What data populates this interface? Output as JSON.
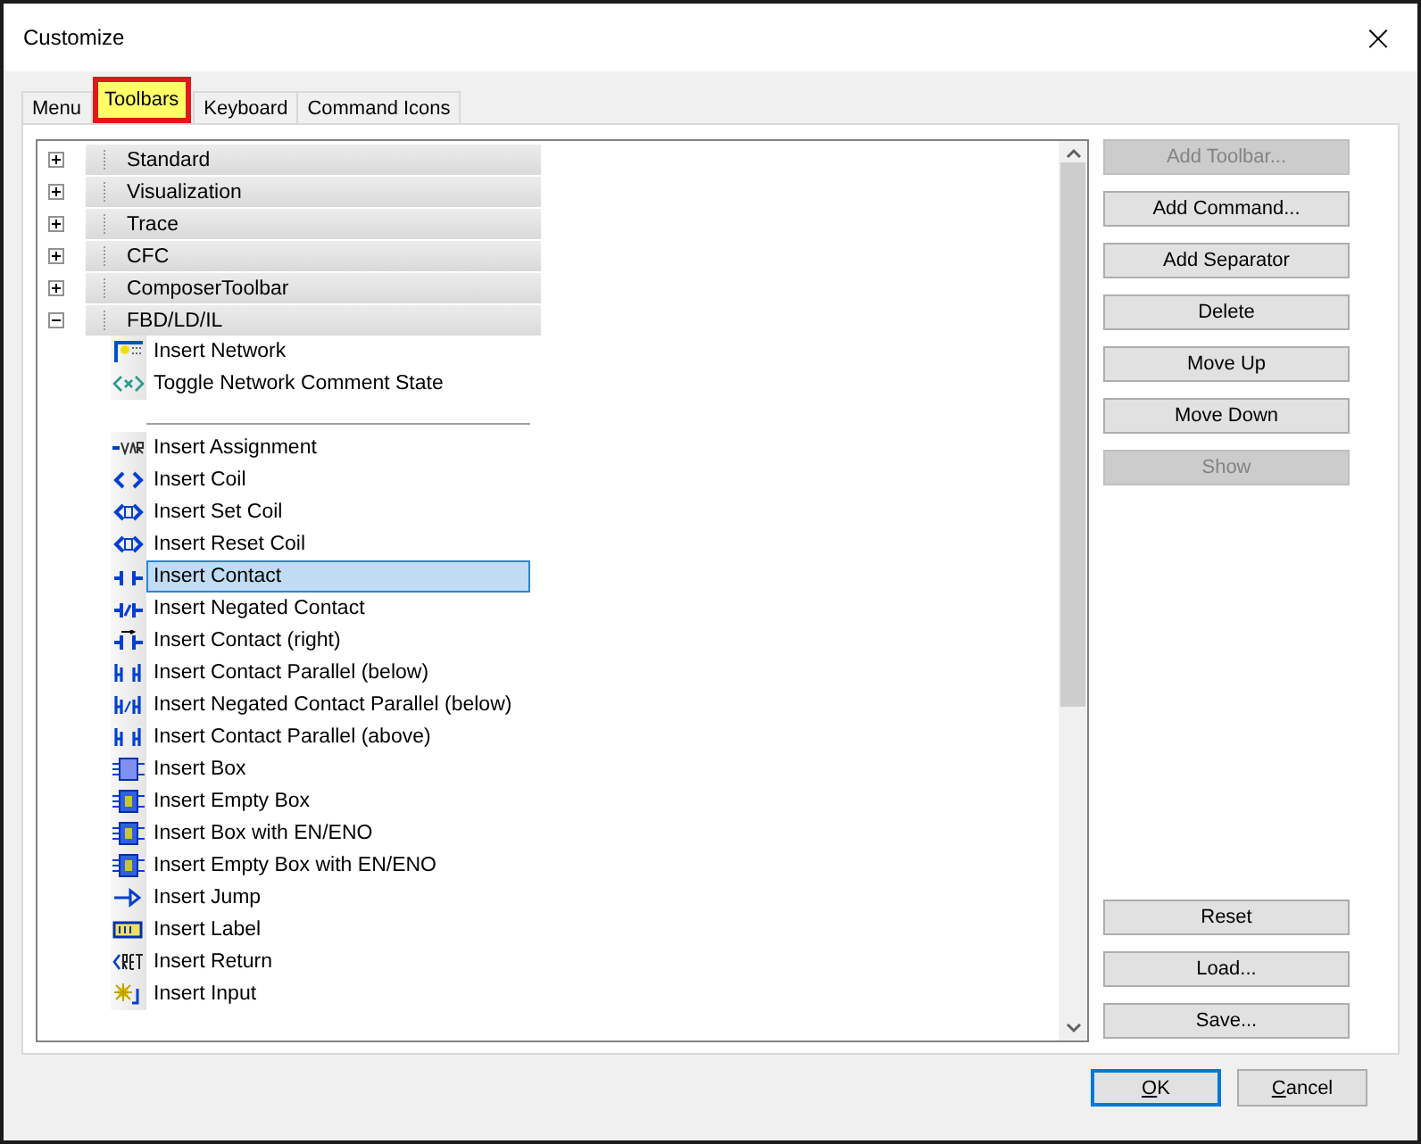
{
  "window": {
    "title": "Customize",
    "close": "×"
  },
  "tabs": [
    {
      "label": "Menu",
      "selected": false
    },
    {
      "label": "Toolbars",
      "selected": true
    },
    {
      "label": "Keyboard",
      "selected": false
    },
    {
      "label": "Command Icons",
      "selected": false
    }
  ],
  "toolbars": [
    {
      "name": "Standard",
      "expanded": false
    },
    {
      "name": "Visualization",
      "expanded": false
    },
    {
      "name": "Trace",
      "expanded": false
    },
    {
      "name": "CFC",
      "expanded": false
    },
    {
      "name": "ComposerToolbar",
      "expanded": false
    },
    {
      "name": "FBD/LD/IL",
      "expanded": true,
      "commands": [
        {
          "kind": "command",
          "label": "Insert Network",
          "selected": false
        },
        {
          "kind": "command",
          "label": "Toggle Network Comment State",
          "selected": false
        },
        {
          "kind": "separator"
        },
        {
          "kind": "command",
          "label": "Insert Assignment",
          "selected": false
        },
        {
          "kind": "command",
          "label": "Insert Coil",
          "selected": false
        },
        {
          "kind": "command",
          "label": "Insert Set Coil",
          "selected": false
        },
        {
          "kind": "command",
          "label": "Insert Reset Coil",
          "selected": false
        },
        {
          "kind": "command",
          "label": "Insert Contact",
          "selected": true
        },
        {
          "kind": "command",
          "label": "Insert Negated Contact",
          "selected": false
        },
        {
          "kind": "command",
          "label": "Insert Contact (right)",
          "selected": false
        },
        {
          "kind": "command",
          "label": "Insert Contact Parallel (below)",
          "selected": false
        },
        {
          "kind": "command",
          "label": "Insert Negated Contact Parallel (below)",
          "selected": false
        },
        {
          "kind": "command",
          "label": "Insert Contact Parallel (above)",
          "selected": false
        },
        {
          "kind": "command",
          "label": "Insert Box",
          "selected": false
        },
        {
          "kind": "command",
          "label": "Insert Empty Box",
          "selected": false
        },
        {
          "kind": "command",
          "label": "Insert Box with EN/ENO",
          "selected": false
        },
        {
          "kind": "command",
          "label": "Insert Empty Box with EN/ENO",
          "selected": false
        },
        {
          "kind": "command",
          "label": "Insert Jump",
          "selected": false
        },
        {
          "kind": "command",
          "label": "Insert Label",
          "selected": false
        },
        {
          "kind": "command",
          "label": "Insert Return",
          "selected": false
        },
        {
          "kind": "command",
          "label": "Insert Input",
          "selected": false
        }
      ]
    }
  ],
  "side_buttons": [
    {
      "label": "Add Toolbar...",
      "disabled": true
    },
    {
      "label": "Add Command...",
      "disabled": false
    },
    {
      "label": "Add Separator",
      "disabled": false
    },
    {
      "label": "Delete",
      "disabled": false
    },
    {
      "label": "Move Up",
      "disabled": false
    },
    {
      "label": "Move Down",
      "disabled": false
    },
    {
      "label": "Show",
      "disabled": true
    }
  ],
  "file_buttons": [
    {
      "label": "Reset",
      "disabled": false
    },
    {
      "label": "Load...",
      "disabled": false
    },
    {
      "label": "Save...",
      "disabled": false
    }
  ],
  "dialog_buttons": [
    {
      "accel": "O",
      "rest": "K",
      "default": true
    },
    {
      "accel": "C",
      "rest": "ancel",
      "default": false
    }
  ]
}
